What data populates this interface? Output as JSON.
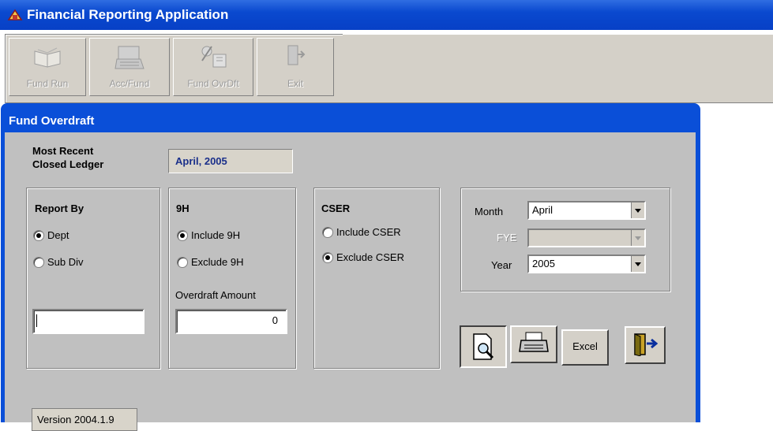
{
  "app": {
    "title": "Financial Reporting Application"
  },
  "toolbar": {
    "fund_run": "Fund Run",
    "acc_fund": "Acc/Fund",
    "fund_ovrdft": "Fund OvrDft",
    "exit": "Exit"
  },
  "window": {
    "title": "Fund Overdraft"
  },
  "ledger": {
    "label_line1": "Most Recent",
    "label_line2": "Closed Ledger",
    "value": "April, 2005"
  },
  "report_by": {
    "title": "Report By",
    "options": [
      {
        "label": "Dept",
        "selected": true
      },
      {
        "label": "Sub Div",
        "selected": false
      }
    ],
    "input_value": ""
  },
  "nine_h": {
    "title": "9H",
    "options": [
      {
        "label": "Include 9H",
        "selected": true
      },
      {
        "label": "Exclude 9H",
        "selected": false
      }
    ],
    "overdraft_label": "Overdraft Amount",
    "overdraft_value": "0"
  },
  "cser": {
    "title": "CSER",
    "options": [
      {
        "label": "Include CSER",
        "selected": false
      },
      {
        "label": "Exclude CSER",
        "selected": true
      }
    ]
  },
  "period": {
    "month_label": "Month",
    "month_value": "April",
    "fye_label": "FYE",
    "fye_value": "",
    "year_label": "Year",
    "year_value": "2005"
  },
  "actions": {
    "excel_label": "Excel"
  },
  "version": "Version 2004.1.9"
}
